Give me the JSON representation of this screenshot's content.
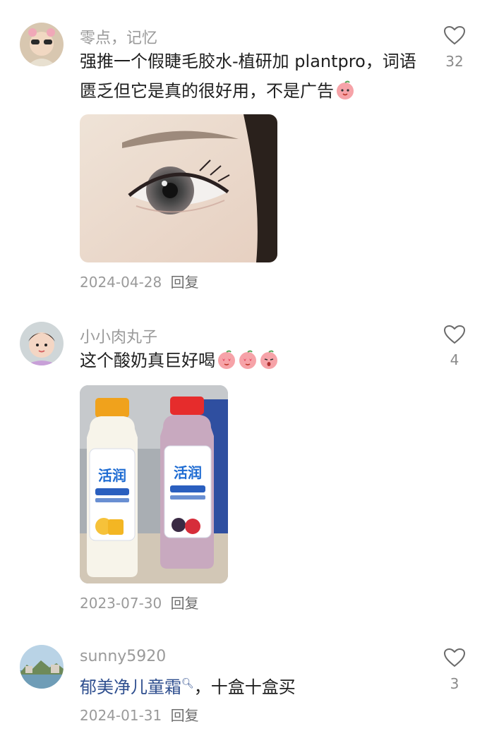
{
  "comments": [
    {
      "username": "零点，记忆",
      "text": "强推一个假睫毛胶水-植研加 plantpro，词语匮乏但它是真的很好用，不是广告",
      "likes": "32",
      "date": "2024-04-28",
      "reply": "回复"
    },
    {
      "username": "小小肉丸子",
      "text": "这个酸奶真巨好喝",
      "likes": "4",
      "date": "2023-07-30",
      "reply": "回复"
    },
    {
      "username": "sunny5920",
      "highlight": "郁美净儿童霜",
      "text": "，十盒十盒买",
      "likes": "3",
      "date": "2024-01-31",
      "reply": "回复"
    }
  ]
}
